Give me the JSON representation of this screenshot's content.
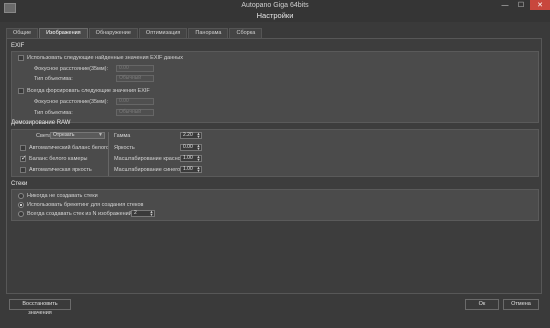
{
  "window": {
    "app_title": "Autopano Giga 64bits",
    "dialog_title": "Настройки"
  },
  "window_buttons": {
    "minimize": "—",
    "maximize": "☐",
    "close": "✕"
  },
  "tabs": [
    {
      "label": "Общие"
    },
    {
      "label": "Изображения"
    },
    {
      "label": "Обнаружение"
    },
    {
      "label": "Оптимизация"
    },
    {
      "label": "Панорама"
    },
    {
      "label": "Сборка"
    }
  ],
  "active_tab": "Изображения",
  "exif": {
    "title": "EXIF",
    "use_found": {
      "label": "Использовать следующие найденные значения EXIF данных",
      "checked": false
    },
    "focal1": {
      "label": "Фокусное расстояние(35мм):",
      "value": "0.00"
    },
    "lens1": {
      "label": "Тип объектива:",
      "value": "Обычный"
    },
    "force": {
      "label": "Всегда форсировать следующие значения EXIF",
      "checked": false
    },
    "focal2": {
      "label": "Фокусное расстояние(35мм):",
      "value": "0.00"
    },
    "lens2": {
      "label": "Тип объектива:",
      "value": "Обычный"
    }
  },
  "raw": {
    "title": "Демозирование RAW",
    "light": {
      "label": "Света",
      "value": "Отрезать"
    },
    "auto_wb": {
      "label": "Автоматический баланс белого",
      "checked": false
    },
    "camera_wb": {
      "label": "Баланс белого камеры",
      "checked": true
    },
    "auto_brightness": {
      "label": "Автоматическая яркость",
      "checked": false
    },
    "gamma": {
      "label": "Гамма",
      "value": "2.20"
    },
    "brightness": {
      "label": "Яркость",
      "value": "0.00"
    },
    "red_scale": {
      "label": "Масштабирование красного",
      "value": "1.00"
    },
    "blue_scale": {
      "label": "Масштабирование синего",
      "value": "1.00"
    }
  },
  "stacks": {
    "title": "Стеки",
    "never": {
      "label": "Никогда не создавать стеки",
      "selected": false
    },
    "bracketing": {
      "label": "Использовать брекетинг для создания стеков",
      "selected": true
    },
    "always": {
      "label": "Всегда создавать стек из N изображений",
      "selected": false,
      "value": "2"
    }
  },
  "footer": {
    "restore": "Восстановить значения",
    "ok": "Ок",
    "cancel": "Отмена"
  }
}
